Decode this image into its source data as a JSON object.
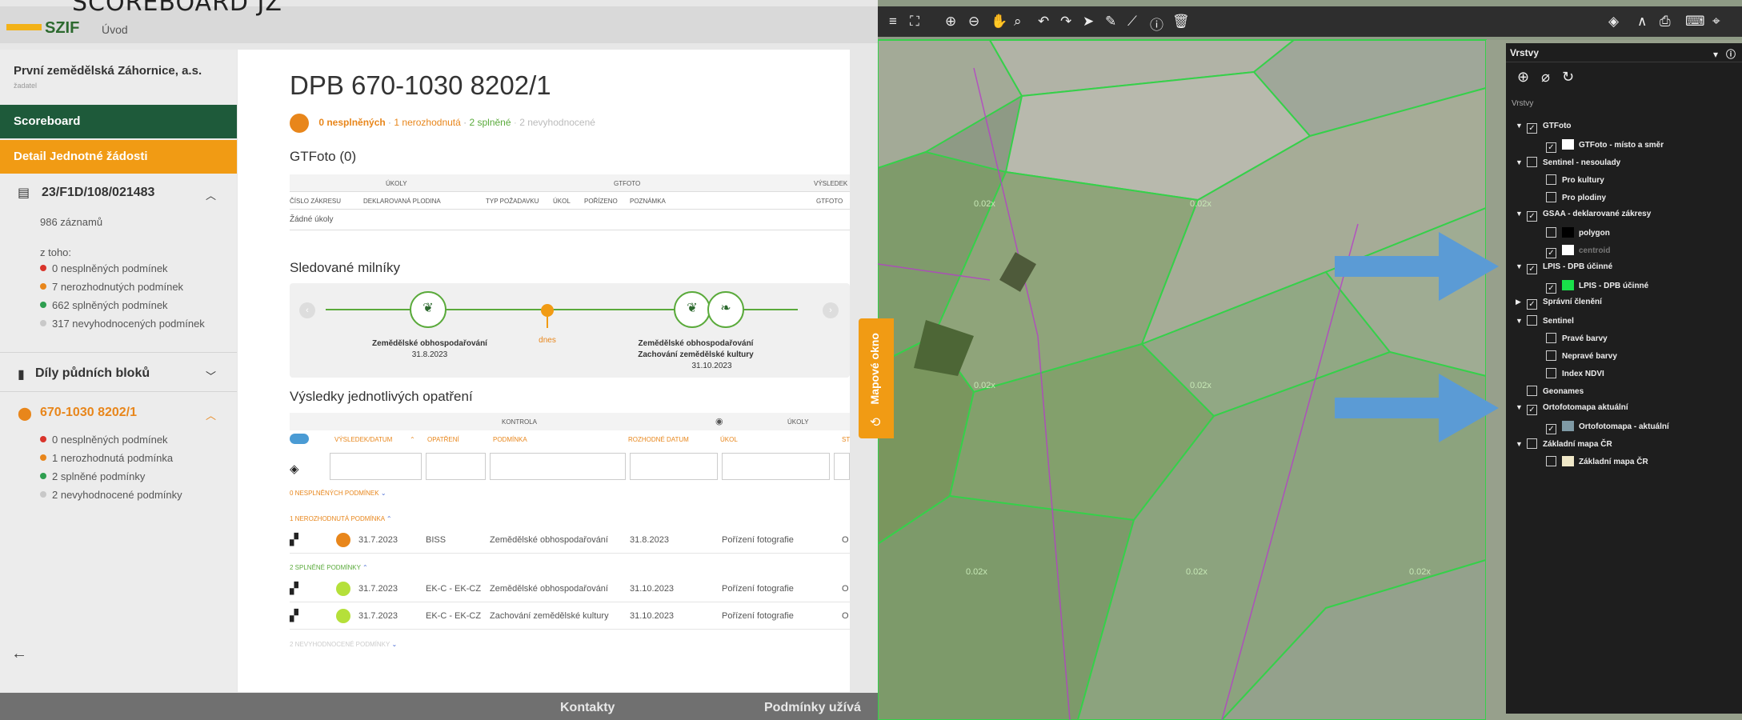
{
  "caption": "SCOREBOARD JZ",
  "app": {
    "logo": "SZIF",
    "nav_home": "Úvod"
  },
  "sidebar": {
    "company": "První zemědělská Záhornice, a.s.",
    "role": "žadatel",
    "nav_scoreboard": "Scoreboard",
    "nav_detail": "Detail Jednotné žádosti",
    "request": {
      "id": "23/F1D/108/021483",
      "records": "986 záznamů",
      "of_which": "z toho:",
      "stats": [
        "0 nesplněných podmínek",
        "7 nerozhodnutých podmínek",
        "662 splněných podmínek",
        "317 nevyhodnocených podmínek"
      ]
    },
    "blocks_title": "Díly půdních bloků",
    "block": {
      "id": "670-1030 8202/1",
      "stats": [
        "0 nesplněných podmínek",
        "1 nerozhodnutá podmínka",
        "2 splněné podmínky",
        "2 nevyhodnocené podmínky"
      ]
    },
    "colors": {
      "red": "#d9342b",
      "orange": "#e8861b",
      "green": "#2e9e4f",
      "grey": "#c8c8c8"
    }
  },
  "main": {
    "title": "DPB 670-1030 8202/1",
    "status": {
      "a": "0 nesplněných",
      "sep": " · ",
      "b": "1 nerozhodnutá",
      "c": "2 splněné",
      "d": "2 nevyhodnocené"
    },
    "gtfoto_title": "GTFoto (0)",
    "gtfoto_table": {
      "group_headers": [
        "ÚKOLY",
        "GTFOTO",
        "VÝSLEDEK"
      ],
      "columns": [
        "ČÍSLO ZÁKRESU",
        "DEKLAROVANÁ PLODINA",
        "TYP POŽADAVKU",
        "ÚKOL",
        "POŘÍZENO",
        "POZNÁMKA",
        "GTFOTO"
      ],
      "empty": "Žádné úkoly"
    },
    "milestones_title": "Sledované milníky",
    "milestones": {
      "m1_label": "Zemědělské obhospodařování",
      "m1_date": "31.8.2023",
      "today": "dnes",
      "m2_label1": "Zemědělské obhospodařování",
      "m2_label2": "Zachování zemědělské kultury",
      "m2_date": "31.10.2023"
    },
    "results_title": "Výsledky jednotlivých opatření",
    "results_table": {
      "group_headers": [
        "KONTROLA",
        "ÚKOLY"
      ],
      "columns": [
        "VÝSLEDEK/DATUM",
        "OPATŘENÍ",
        "PODMÍNKA",
        "ROZHODNÉ DATUM",
        "ÚKOL",
        "ST"
      ],
      "groups": [
        "0 NESPLNĚNÝCH PODMÍNEK",
        "1 NEROZHODNUTÁ PODMÍNKA",
        "2 SPLNĚNÉ PODMÍNKY",
        "2 NEVYHODNOCENÉ PODMÍNKY"
      ],
      "rows": [
        {
          "date": "31.7.2023",
          "measure": "BISS",
          "condition": "Zemědělské obhospodařování",
          "deadline": "31.8.2023",
          "task": "Pořízení fotografie",
          "st": "O",
          "color": "#e8861b"
        },
        {
          "date": "31.7.2023",
          "measure": "EK-C - EK-CZ",
          "condition": "Zemědělské obhospodařování",
          "deadline": "31.10.2023",
          "task": "Pořízení fotografie",
          "st": "O",
          "color": "#b5e03a"
        },
        {
          "date": "31.7.2023",
          "measure": "EK-C - EK-CZ",
          "condition": "Zachování zemědělské kultury",
          "deadline": "31.10.2023",
          "task": "Pořízení fotografie",
          "st": "O",
          "color": "#b5e03a"
        }
      ]
    },
    "map_tab": "Mapové okno"
  },
  "footer": {
    "contacts": "Kontakty",
    "terms": "Podmínky užívá"
  },
  "map": {
    "parcel_labels": [
      "0.02x",
      "0.02x",
      "0.02x",
      "0.02x",
      "0.02x",
      "0.02x",
      "0.02x"
    ]
  },
  "layers": {
    "title": "Vrstvy",
    "subtitle": "Vrstvy",
    "items": [
      {
        "caret": "▼",
        "checked": true,
        "label": "GTFoto",
        "swatch": "",
        "indent": 0
      },
      {
        "caret": "",
        "checked": true,
        "label": "GTFoto - místo a směr",
        "swatch": "#ffffff",
        "indent": 1
      },
      {
        "caret": "▼",
        "checked": false,
        "label": "Sentinel - nesoulady",
        "swatch": "",
        "indent": 0
      },
      {
        "caret": "",
        "checked": false,
        "label": "Pro kultury",
        "swatch": "",
        "indent": 1
      },
      {
        "caret": "",
        "checked": false,
        "label": "Pro plodiny",
        "swatch": "",
        "indent": 1
      },
      {
        "caret": "▼",
        "checked": true,
        "label": "GSAA - deklarované zákresy",
        "swatch": "",
        "indent": 0
      },
      {
        "caret": "",
        "checked": false,
        "label": "polygon",
        "swatch": "#000000",
        "indent": 1
      },
      {
        "caret": "",
        "checked": true,
        "label": "centroid",
        "swatch": "#ffffff",
        "indent": 1
      },
      {
        "caret": "▼",
        "checked": true,
        "label": "LPIS - DPB účinné",
        "swatch": "",
        "indent": 0
      },
      {
        "caret": "",
        "checked": true,
        "label": "LPIS - DPB účinné",
        "swatch": "#19e04a",
        "indent": 1
      },
      {
        "caret": "▶",
        "checked": true,
        "label": "Správní členění",
        "swatch": "",
        "indent": 0
      },
      {
        "caret": "▼",
        "checked": false,
        "label": "Sentinel",
        "swatch": "",
        "indent": 0
      },
      {
        "caret": "",
        "checked": false,
        "label": "Pravé barvy",
        "swatch": "",
        "indent": 1
      },
      {
        "caret": "",
        "checked": false,
        "label": "Nepravé barvy",
        "swatch": "",
        "indent": 1
      },
      {
        "caret": "",
        "checked": false,
        "label": "Index NDVI",
        "swatch": "",
        "indent": 1
      },
      {
        "caret": "",
        "checked": false,
        "label": "Geonames",
        "swatch": "",
        "indent": 0
      },
      {
        "caret": "▼",
        "checked": true,
        "label": "Ortofotomapa aktuální",
        "swatch": "",
        "indent": 0
      },
      {
        "caret": "",
        "checked": true,
        "label": "Ortofotomapa - aktuální",
        "swatch": "#7f9aa5",
        "indent": 1
      },
      {
        "caret": "▼",
        "checked": false,
        "label": "Základní mapa ČR",
        "swatch": "",
        "indent": 0
      },
      {
        "caret": "",
        "checked": false,
        "label": "Základní mapa ČR",
        "swatch": "#f0e8c8",
        "indent": 1
      }
    ]
  }
}
